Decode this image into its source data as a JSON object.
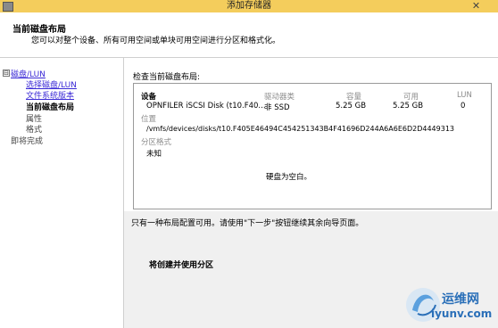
{
  "window": {
    "title": "添加存储器",
    "close_glyph": "✕"
  },
  "header": {
    "title": "当前磁盘布局",
    "description": "您可以对整个设备、所有可用空间或单块可用空间进行分区和格式化。"
  },
  "nav": {
    "toggle": "⊟",
    "items": [
      {
        "label": "磁盘/LUN",
        "link": true
      },
      {
        "label": "选择磁盘/LUN",
        "link": true
      },
      {
        "label": "文件系统版本",
        "link": true
      },
      {
        "label": "当前磁盘布局",
        "current": true
      },
      {
        "label": "属性"
      },
      {
        "label": "格式"
      },
      {
        "label": "即将完成"
      }
    ]
  },
  "main": {
    "review_label": "检查当前磁盘布局:",
    "columns": {
      "device": "设备",
      "driver_type": "驱动器类",
      "capacity": "容量",
      "available": "可用",
      "lun": "LUN"
    },
    "device": {
      "name": "OPNFILER iSCSI Disk (t10.F40...",
      "driver_type": "非 SSD",
      "capacity": "5.25 GB",
      "available": "5.25 GB",
      "lun": "0"
    },
    "location_label": "位置",
    "location": "/vmfs/devices/disks/t10.F405E46494C454251343B4F41696D244A6A6E6D2D4449313",
    "partition_format_label": "分区格式",
    "partition_format": "未知",
    "empty_message": "硬盘为空白。",
    "hint": "只有一种布局配置可用。请使用\"下一步\"按钮继续其余向导页面。",
    "create_text": "将创建并使用分区"
  },
  "watermark": {
    "brand": "运维网",
    "url": "iyunv.com"
  },
  "colors": {
    "titlebar": "#f4cd5c",
    "link": "#3b2ad6",
    "bottom_panel": "#f0f0f0",
    "watermark": "#2a6fb8"
  }
}
